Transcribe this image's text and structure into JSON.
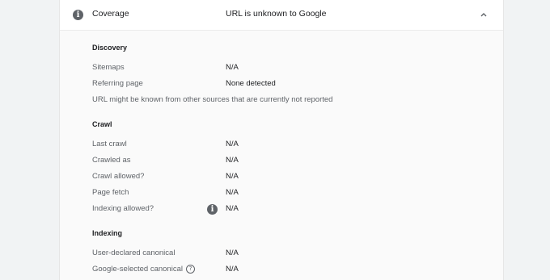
{
  "header": {
    "label": "Coverage",
    "value": "URL is unknown to Google"
  },
  "discovery": {
    "title": "Discovery",
    "rows": [
      {
        "label": "Sitemaps",
        "value": "N/A"
      },
      {
        "label": "Referring page",
        "value": "None detected"
      }
    ],
    "note": "URL might be known from other sources that are currently not reported"
  },
  "crawl": {
    "title": "Crawl",
    "rows": [
      {
        "label": "Last crawl",
        "value": "N/A"
      },
      {
        "label": "Crawled as",
        "value": "N/A"
      },
      {
        "label": "Crawl allowed?",
        "value": "N/A"
      },
      {
        "label": "Page fetch",
        "value": "N/A"
      },
      {
        "label": "Indexing allowed?",
        "value": "N/A"
      }
    ]
  },
  "indexing": {
    "title": "Indexing",
    "rows": [
      {
        "label": "User-declared canonical",
        "value": "N/A"
      },
      {
        "label": "Google-selected canonical",
        "value": "N/A"
      }
    ]
  },
  "icons": {
    "info": "info-icon",
    "collapse": "chevron-up-icon",
    "help": "help-icon"
  }
}
